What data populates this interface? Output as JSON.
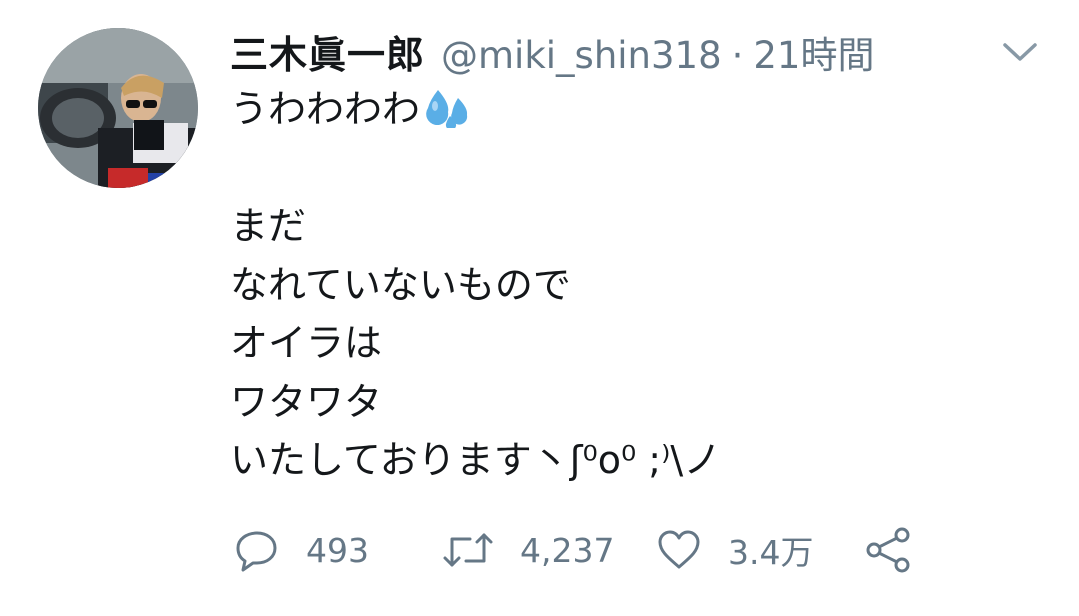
{
  "tweet": {
    "display_name": "三木眞一郎",
    "handle": "@miki_shin318",
    "separator": "·",
    "time": "21時間",
    "body_first": "うわわわわ",
    "body_lines": [
      "",
      "まだ",
      "なれていないもので",
      "オイラは",
      "ワタワタ",
      "いたしております丶ʃ⁰o⁰ ;⁾\\ノ"
    ],
    "emoji": "sweat-droplets-icon"
  },
  "actions": {
    "reply_count": "493",
    "retweet_count": "4,237",
    "like_count": "3.4万"
  },
  "colors": {
    "text": "#14171a",
    "secondary": "#657786",
    "droplet": "#5aaee6"
  }
}
